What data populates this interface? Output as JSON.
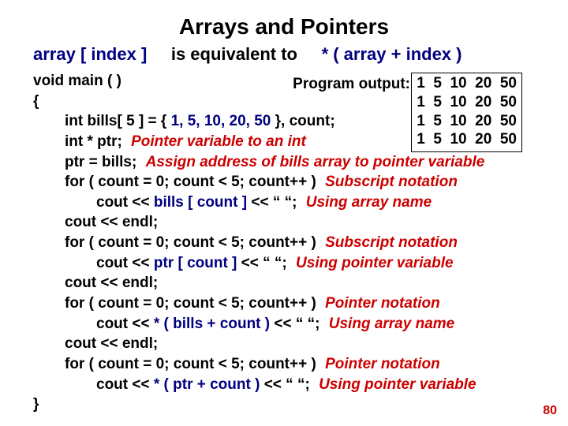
{
  "title": "Arrays and Pointers",
  "equiv": {
    "left": "array [ index ]",
    "mid": "is equivalent to",
    "right": "* ( array + index )"
  },
  "out_label": "Program output:",
  "output_rows": [
    "1  5  10  20  50",
    "1  5  10  20  50",
    "1  5  10  20  50",
    "1  5  10  20  50"
  ],
  "code": {
    "l0a": "void main ( )",
    "l0b": "{",
    "l1a": "int bills[ 5 ] = { ",
    "l1b": "1, 5, 10, 20, 50",
    "l1c": " }, count;",
    "l2a": "int * ptr;",
    "l2ann": "Pointer variable to an int",
    "l3a": "ptr = bills;",
    "l3ann": "Assign address of bills array to pointer variable",
    "l4": "for ( count = 0; count < 5; count++ )",
    "l4ann": "Subscript notation",
    "l5a": "cout << ",
    "l5b": "bills [ count ]",
    "l5c": " << “   “;",
    "l5ann": "Using array name",
    "l6": "cout << endl;",
    "l7": "for ( count = 0; count < 5; count++ )",
    "l7ann": "Subscript notation",
    "l8a": "cout << ",
    "l8b": "ptr [ count ]",
    "l8c": " << “   “;",
    "l8ann": "Using pointer variable",
    "l9": "cout << endl;",
    "l10": "for ( count = 0; count < 5; count++ )",
    "l10ann": "Pointer notation",
    "l11a": "cout << ",
    "l11b": "* ( bills + count )",
    "l11c": " << “   “;",
    "l11ann": "Using array name",
    "l12": "cout << endl;",
    "l13": "for ( count = 0; count < 5; count++ )",
    "l13ann": "Pointer notation",
    "l14a": "cout << ",
    "l14b": "* ( ptr + count )",
    "l14c": " << “   “;",
    "l14ann": "Using pointer variable",
    "l15": "}"
  },
  "page_num": "80"
}
